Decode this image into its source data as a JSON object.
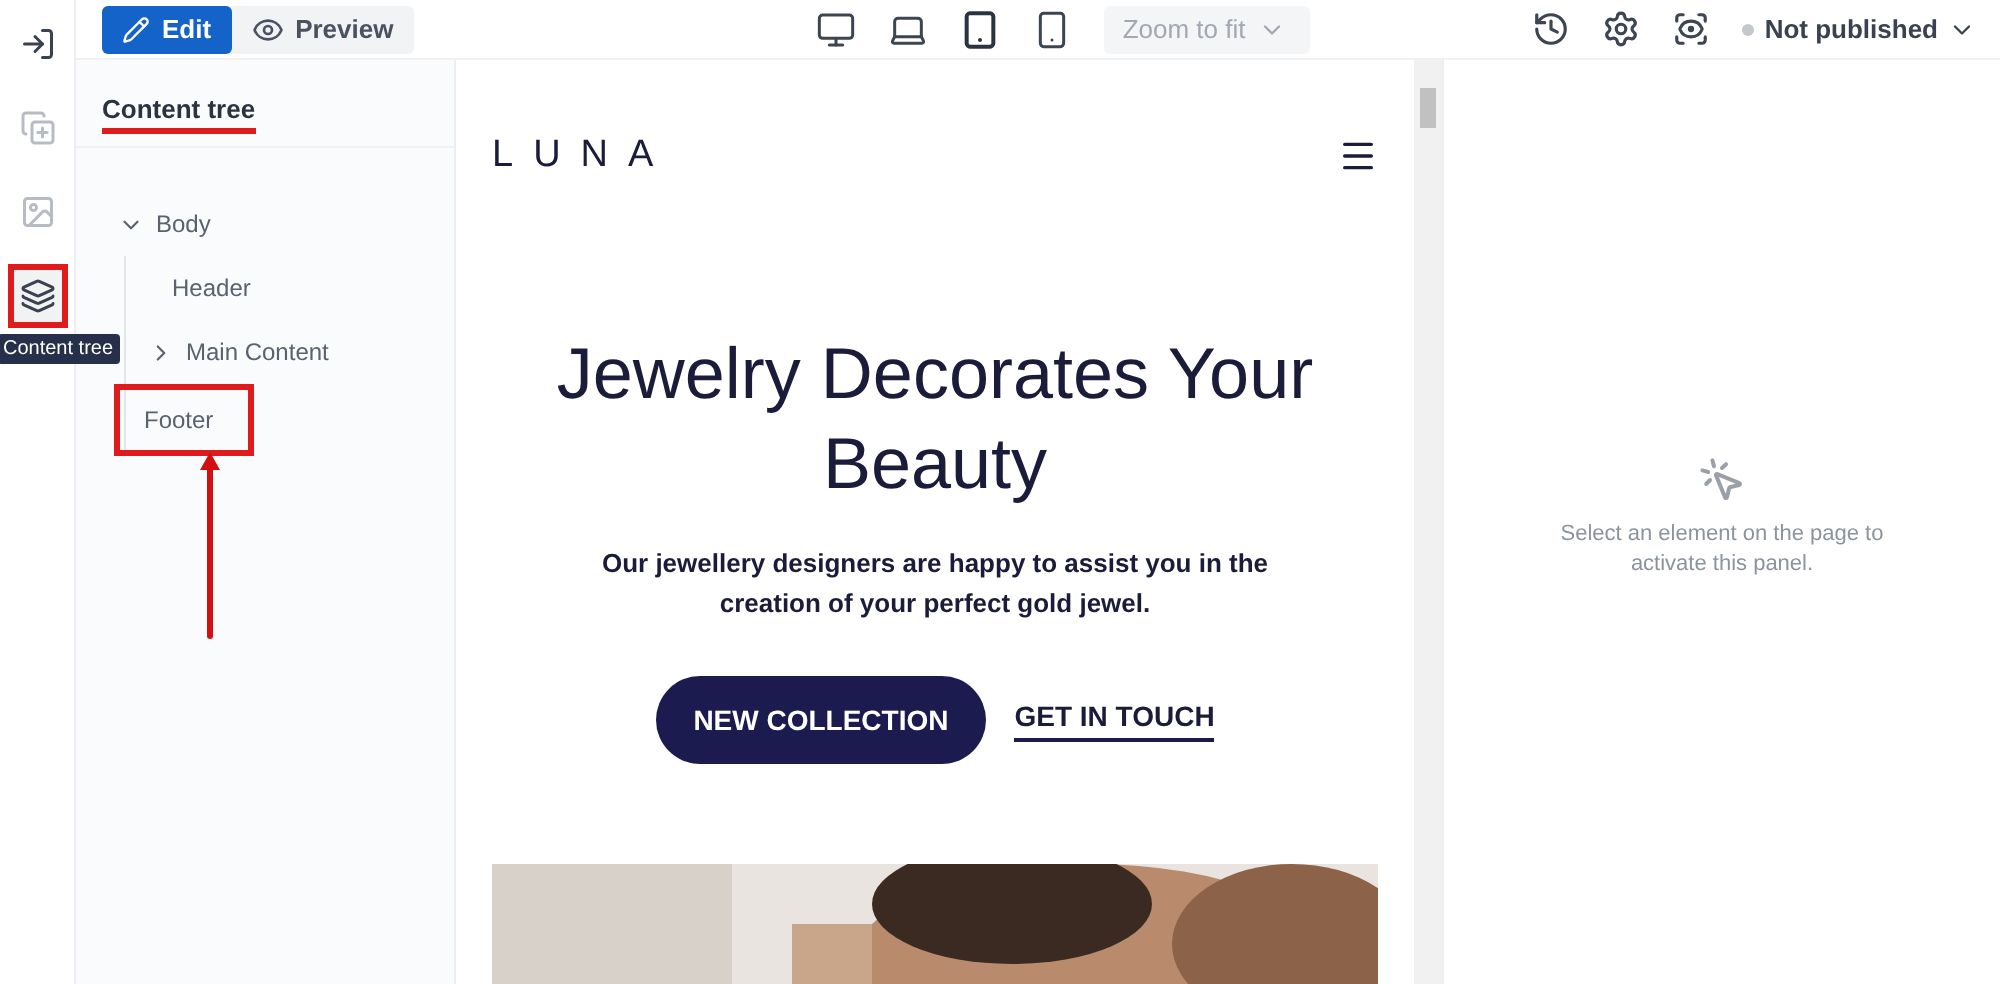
{
  "mode_toggle": [
    {
      "label": "Edit",
      "selected": true
    },
    {
      "label": "Preview",
      "selected": false
    }
  ],
  "devices": [
    {
      "kind": "desktop",
      "selected": false
    },
    {
      "kind": "laptop",
      "selected": false
    },
    {
      "kind": "tablet",
      "selected": true
    },
    {
      "kind": "mobile",
      "selected": false
    }
  ],
  "zoom": {
    "value": "Zoom to fit",
    "disabled": true
  },
  "status": {
    "label": "Not published",
    "color": "#c4c7cc"
  },
  "rail": [
    {
      "kind": "exit",
      "selected": false
    },
    {
      "kind": "add",
      "selected": false
    },
    {
      "kind": "media",
      "selected": false
    },
    {
      "kind": "layers",
      "selected": true,
      "tooltip": "Content tree"
    }
  ],
  "panel": {
    "title": "Content tree"
  },
  "tree": [
    {
      "label": "Body",
      "expanded": true,
      "highlighted": false,
      "children": [
        {
          "label": "Header",
          "highlighted": false
        },
        {
          "label": "Main Content",
          "expanded": false,
          "highlighted": false
        },
        {
          "label": "Footer",
          "highlighted": true
        }
      ]
    }
  ],
  "site": {
    "logo": "LUNA",
    "heading": "Jewelry Decorates Your Beauty",
    "text": "Our jewellery designers are happy to assist you in the creation of your perfect gold jewel.",
    "buttons": [
      {
        "label": "NEW COLLECTION",
        "kind": "filled"
      },
      {
        "label": "GET IN TOUCH",
        "kind": "link"
      }
    ]
  },
  "inspector": {
    "hint": "Select an element on the page to activate this panel."
  }
}
